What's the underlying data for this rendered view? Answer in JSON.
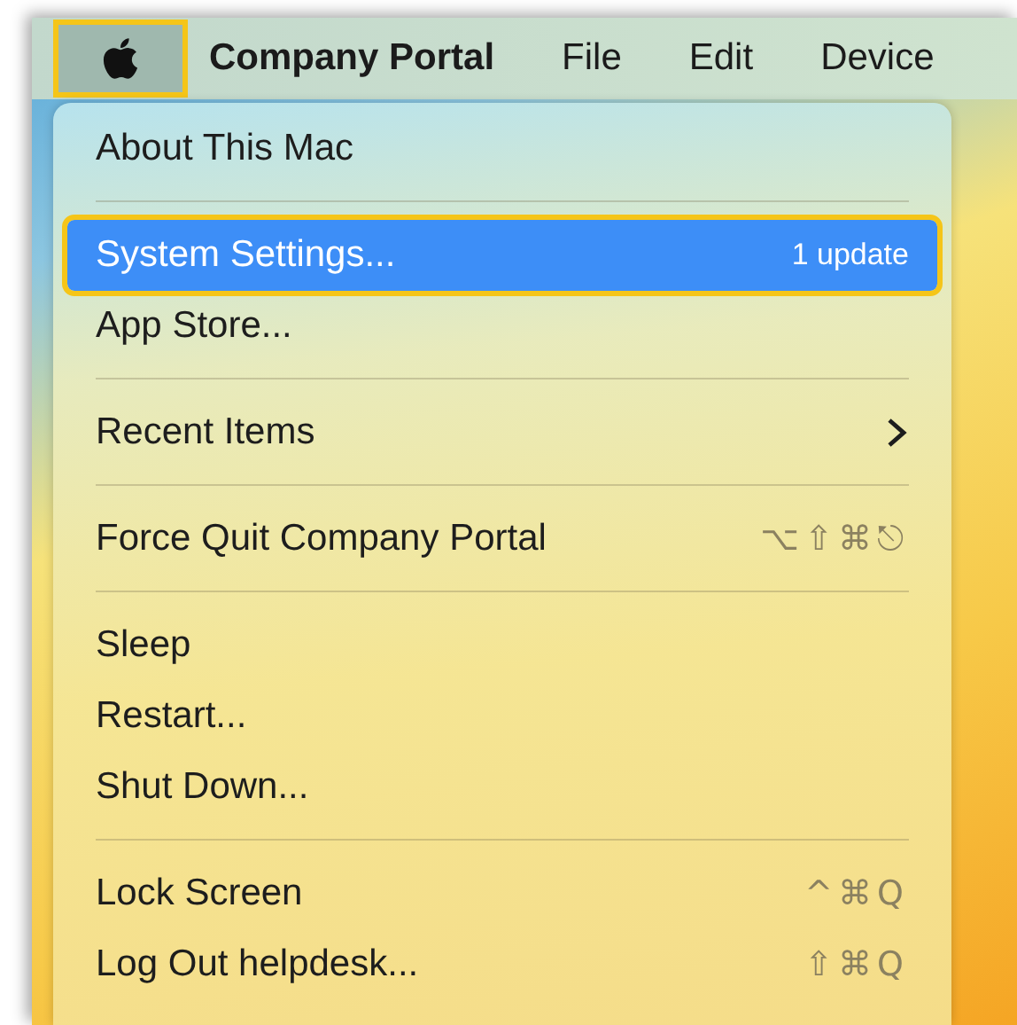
{
  "menu_bar": {
    "apple_menu": {
      "selected": true
    },
    "items": [
      {
        "label": "Company Portal",
        "kind": "app"
      },
      {
        "label": "File",
        "kind": "menu"
      },
      {
        "label": "Edit",
        "kind": "menu"
      },
      {
        "label": "Device",
        "kind": "menu"
      }
    ]
  },
  "apple_menu": {
    "groups": [
      [
        {
          "label": "About This Mac",
          "selected": false
        }
      ],
      [
        {
          "label": "System Settings...",
          "badge": "1 update",
          "selected": true
        },
        {
          "label": "App Store...",
          "selected": false
        }
      ],
      [
        {
          "label": "Recent Items",
          "submenu": true,
          "selected": false
        }
      ],
      [
        {
          "label": "Force Quit Company Portal",
          "shortcut": "⌥⇧⌘⎋",
          "selected": false
        }
      ],
      [
        {
          "label": "Sleep",
          "selected": false
        },
        {
          "label": "Restart...",
          "selected": false
        },
        {
          "label": "Shut Down...",
          "selected": false
        }
      ],
      [
        {
          "label": "Lock Screen",
          "shortcut": "^⌘Q",
          "selected": false
        },
        {
          "label": "Log Out helpdesk...",
          "shortcut": "⇧⌘Q",
          "selected": false
        }
      ]
    ]
  }
}
